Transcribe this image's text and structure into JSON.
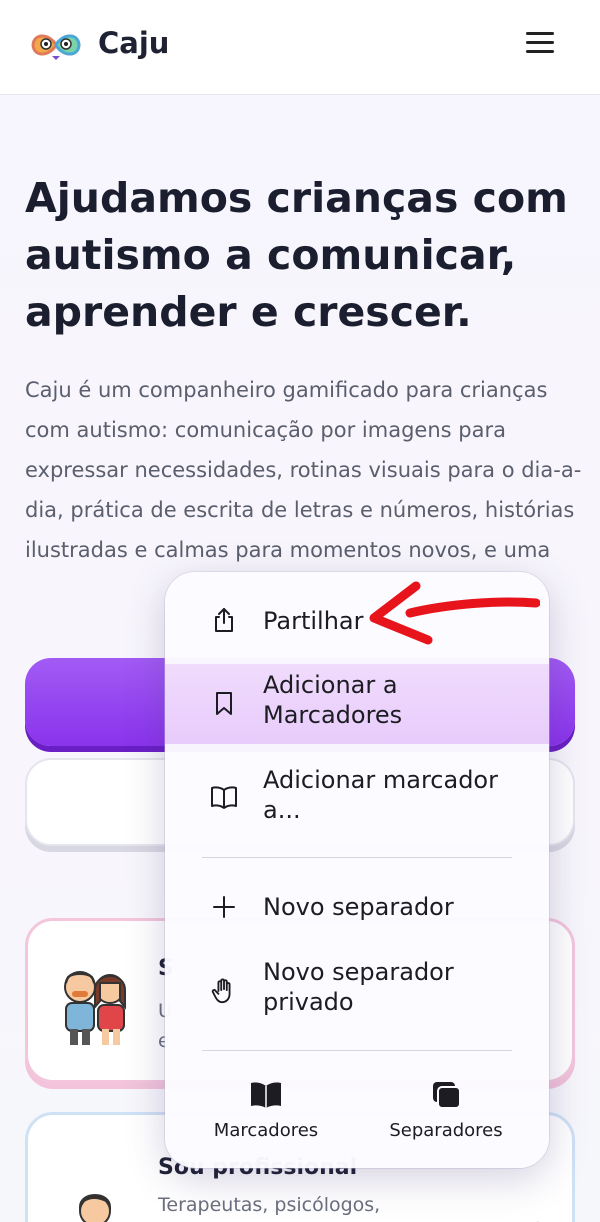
{
  "header": {
    "brand": "Caju",
    "menu_icon": "hamburger-icon",
    "logo_icon": "infinity-eyes-logo"
  },
  "hero": {
    "title": "Ajudamos crianças com autismo a comunicar, aprender e crescer.",
    "description": "Caju é um companheiro gamificado para crianças com autismo: comunicação por imagens para expressar necessidades, rotinas visuais para o dia-a-dia, prática de escrita de letras e números, histórias ilustradas e calmas para momentos novos, e uma"
  },
  "cards": {
    "parent": {
      "title": "S",
      "text_line1": "U",
      "text_line2": "e",
      "icon": "parents-icon"
    },
    "pro": {
      "title": "Sou profissional",
      "text": "Terapeutas, psicólogos,",
      "icon": "professional-icon"
    }
  },
  "context_menu": {
    "items": [
      {
        "label": "Partilhar",
        "icon": "share-icon"
      },
      {
        "label": "Adicionar a Marcadores",
        "icon": "bookmark-icon"
      },
      {
        "label": "Adicionar marcador a...",
        "icon": "book-icon"
      },
      {
        "label": "Novo separador",
        "icon": "plus-icon"
      },
      {
        "label": "Novo separador privado",
        "icon": "hand-icon"
      }
    ],
    "bottom": [
      {
        "label": "Marcadores",
        "icon": "open-book-icon"
      },
      {
        "label": "Separadores",
        "icon": "tabs-icon"
      }
    ]
  },
  "colors": {
    "primary_button": "#9446f0",
    "highlight": "#e6c8fa",
    "annotation_arrow": "#e8141c"
  }
}
